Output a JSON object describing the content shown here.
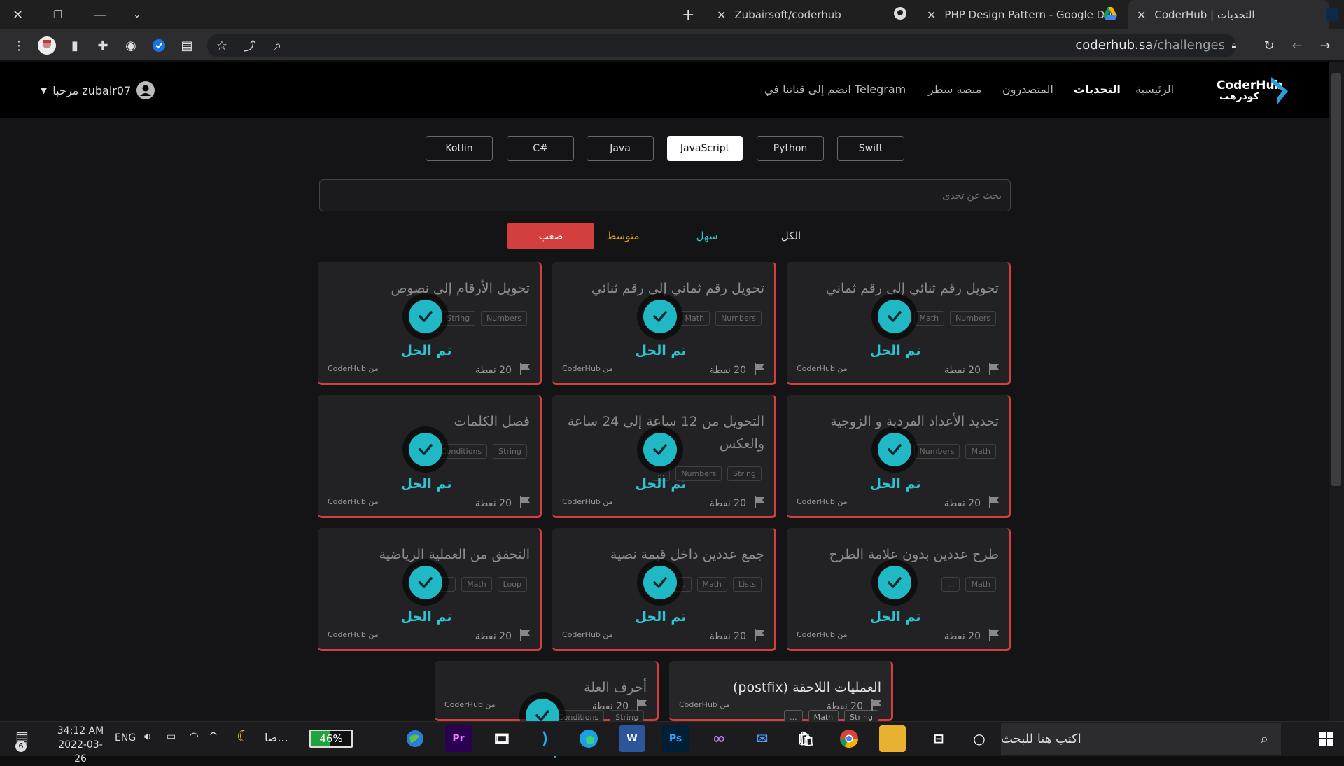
{
  "browser": {
    "tabs": [
      {
        "label": "Zubairsoft/coderhub"
      },
      {
        "label": "PHP Design Pattern - Google Dri"
      },
      {
        "label": "CoderHub | التحديات"
      }
    ],
    "url_host": "coderhub.sa",
    "url_path": "/challenges"
  },
  "site": {
    "logo_text": "CoderHub",
    "logo_arabic": "كودرهب",
    "nav": [
      "الرئيسية",
      "التحديات",
      "المتصدرون",
      "منصة سطر",
      "انضم إلى قناتنا في Telegram"
    ],
    "user": "مرحبا zubair07"
  },
  "languages": [
    "Kotlin",
    "C#",
    "Java",
    "JavaScript",
    "Python",
    "Swift"
  ],
  "active_language": "JavaScript",
  "search_placeholder": "بحث عن تحدى",
  "difficulty": {
    "hard": "صعب",
    "medium": "متوسط",
    "easy": "سهل",
    "all": "الكل"
  },
  "colors": {
    "accent": "#21b8c6",
    "hard": "#d33f3f",
    "medium": "#e0a020",
    "easy": "#2ec4d3"
  },
  "card_common": {
    "solved": "تم الحل",
    "points": "20 نقطة",
    "source": "من CoderHub"
  },
  "cards": [
    {
      "title": "تحويل رقم ثنائي إلى رقم ثماني",
      "tags": [
        "Numbers",
        "Math"
      ]
    },
    {
      "title": "تحويل رقم ثماني إلى رقم ثنائي",
      "tags": [
        "Numbers",
        "Math"
      ]
    },
    {
      "title": "تحويل الأرقام إلى نصوص",
      "tags": [
        "Numbers",
        "String"
      ]
    },
    {
      "title": "تحديد الأعداد الفردية و الزوجية",
      "tags": [
        "Math",
        "Numbers"
      ]
    },
    {
      "title": "التحويل من 12 ساعة إلى 24 ساعة والعكس",
      "tags": [
        "String",
        "Numbers",
        "..."
      ]
    },
    {
      "title": "فصل الكلمات",
      "tags": [
        "String",
        "Conditions"
      ]
    },
    {
      "title": "طرح عددين بدون علامة الطرح",
      "tags": [
        "Math",
        "..."
      ]
    },
    {
      "title": "جمع عددين داخل قيمة نصية",
      "tags": [
        "Lists",
        "Math",
        "..."
      ]
    },
    {
      "title": "التحقق من العملية الرياضية",
      "tags": [
        "Loop",
        "Math",
        "..."
      ]
    },
    {
      "title": "العمليات اللاحقة (postfix)",
      "tags": [
        "String",
        "Math",
        "..."
      ]
    },
    {
      "title": "أحرف العلة",
      "tags": [
        "String",
        "Conditions"
      ]
    }
  ],
  "taskbar": {
    "search": "اكتب هنا للبحث",
    "time": "34:12 AM",
    "date": "2022-03-26",
    "lang": "ENG",
    "battery": "46%",
    "weather": "صا...",
    "notif": "6"
  }
}
